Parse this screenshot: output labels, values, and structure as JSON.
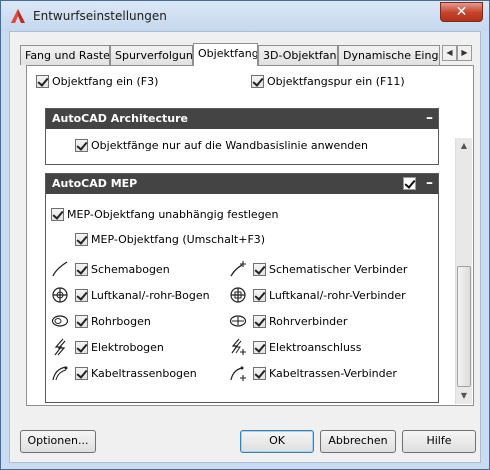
{
  "window": {
    "title": "Entwurfseinstellungen",
    "close_symbol": "✕",
    "icon": "autocad-a-icon"
  },
  "tabs": [
    {
      "label": "Fang und Raster",
      "active": false
    },
    {
      "label": "Spurverfolgung",
      "active": false
    },
    {
      "label": "Objektfang",
      "active": true
    },
    {
      "label": "3D-Objektfang",
      "active": false
    },
    {
      "label": "Dynamische Eingabe",
      "active": false
    }
  ],
  "tab_scroll": {
    "left": "◀",
    "right": "▶"
  },
  "top_options": {
    "objektfang_ein": "Objektfang ein (F3)",
    "objektfangspur_ein": "Objektfangspur ein (F11)"
  },
  "architecture": {
    "title": "AutoCAD Architecture",
    "collapse": "–",
    "option": "Objektfänge nur auf die Wandbasislinie anwenden"
  },
  "mep": {
    "title": "AutoCAD MEP",
    "collapse": "–",
    "independent": "MEP-Objektfang unabhängig festlegen",
    "shift_option": "MEP-Objektfang (Umschalt+F3)",
    "left_items": [
      {
        "label": "Schemabogen",
        "icon": "schematic-arc-icon"
      },
      {
        "label": "Luftkanal/-rohr-Bogen",
        "icon": "duct-curve-icon"
      },
      {
        "label": "Rohrbogen",
        "icon": "pipe-curve-icon"
      },
      {
        "label": "Elektrobogen",
        "icon": "electrical-curve-icon"
      },
      {
        "label": "Kabeltrassenbogen",
        "icon": "cable-tray-curve-icon"
      }
    ],
    "right_items": [
      {
        "label": "Schematischer Verbinder",
        "icon": "schematic-connector-icon"
      },
      {
        "label": "Luftkanal/-rohr-Verbinder",
        "icon": "duct-connector-icon"
      },
      {
        "label": "Rohrverbinder",
        "icon": "pipe-connector-icon"
      },
      {
        "label": "Elektroanschluss",
        "icon": "electrical-connection-icon"
      },
      {
        "label": "Kabeltrassen-Verbinder",
        "icon": "cable-tray-connector-icon"
      }
    ]
  },
  "buttons": {
    "options": "Optionen...",
    "ok": "OK",
    "cancel": "Abbrechen",
    "help": "Hilfe"
  }
}
